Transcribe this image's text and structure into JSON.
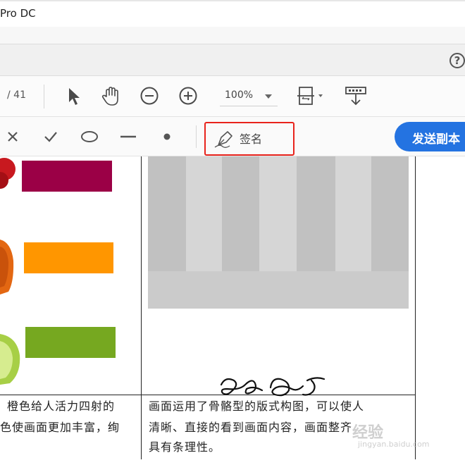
{
  "window": {
    "title": "Pro DC"
  },
  "toolbar": {
    "page_total": "/ 41",
    "zoom": "100%"
  },
  "sign_toolbar": {
    "sign_label": "签名",
    "send_copy_label": "发送副本"
  },
  "document": {
    "swatch_colors": [
      "#9b0046",
      "#ff9600",
      "#76a820"
    ],
    "left_caption": {
      "line1": "橙色给人活力四射的",
      "line2": "色使画面更加丰富，绚"
    },
    "right_caption": {
      "line1": "画面运用了骨骼型的版式构图，可以使人",
      "line2": "清晰、直接的看到画面内容，画面整齐",
      "line3": "具有条理性。"
    }
  },
  "watermark": {
    "text": "经验",
    "domain": "jingyan.baidu.com"
  }
}
